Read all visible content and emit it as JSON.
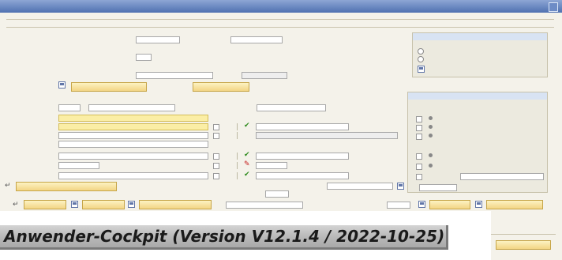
{
  "caption": {
    "text": "Anwender-Cockpit (Version V12.1.4 / 2022-10-25)"
  },
  "colors": {
    "title_bar": "#4f71b1",
    "window_background": "#f4f2ea",
    "panel_background": "#eceadf",
    "highlighted_field": "#fbeea5",
    "button": "#f3d585",
    "ok_mark": "#2f8c1f",
    "error_mark": "#c41818"
  },
  "icons": {
    "close": "close-icon",
    "check": "check-icon",
    "warning": "warning-icon",
    "save": "save-icon",
    "return": "return-icon",
    "dropdown": "chevron-down-icon"
  }
}
